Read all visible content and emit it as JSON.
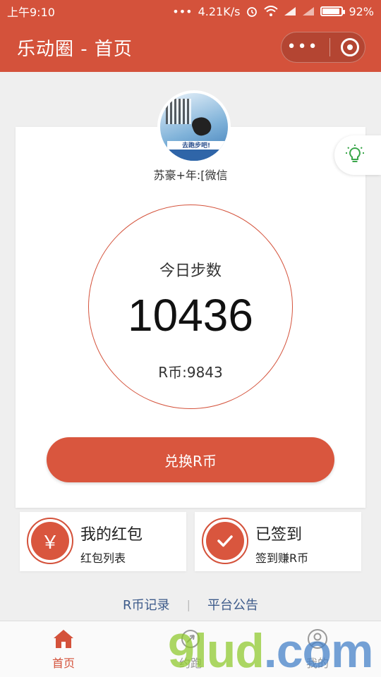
{
  "status_bar": {
    "time": "上午9:10",
    "network_speed": "4.21K/s",
    "battery": "92%",
    "battery_level": 0.92
  },
  "header": {
    "title": "乐动圈 - 首页"
  },
  "profile": {
    "username": "苏豪+年:[微信",
    "avatar_banner_text": "去跑步吧!"
  },
  "steps": {
    "label": "今日步数",
    "count": "10436",
    "balance": "R币:9843"
  },
  "actions": {
    "exchange_label": "兑换R币"
  },
  "cards": {
    "red_packet": {
      "title": "我的红包",
      "subtitle": "红包列表",
      "icon_glyph": "￥"
    },
    "checkin": {
      "title": "已签到",
      "subtitle": "签到赚R币"
    }
  },
  "links": {
    "record": "R币记录",
    "separator": "|",
    "notice": "平台公告"
  },
  "tabs": [
    {
      "label": "首页",
      "icon": "home-icon",
      "active": true
    },
    {
      "label": "约跑",
      "icon": "run-icon",
      "active": false
    },
    {
      "label": "我的",
      "icon": "user-icon",
      "active": false
    }
  ],
  "watermark": {
    "text": "9lud",
    "suffix": ".com"
  },
  "colors": {
    "accent": "#d4523b",
    "button": "#d9563e",
    "link": "#3c5a8a",
    "hint_icon": "#3aa64a"
  }
}
